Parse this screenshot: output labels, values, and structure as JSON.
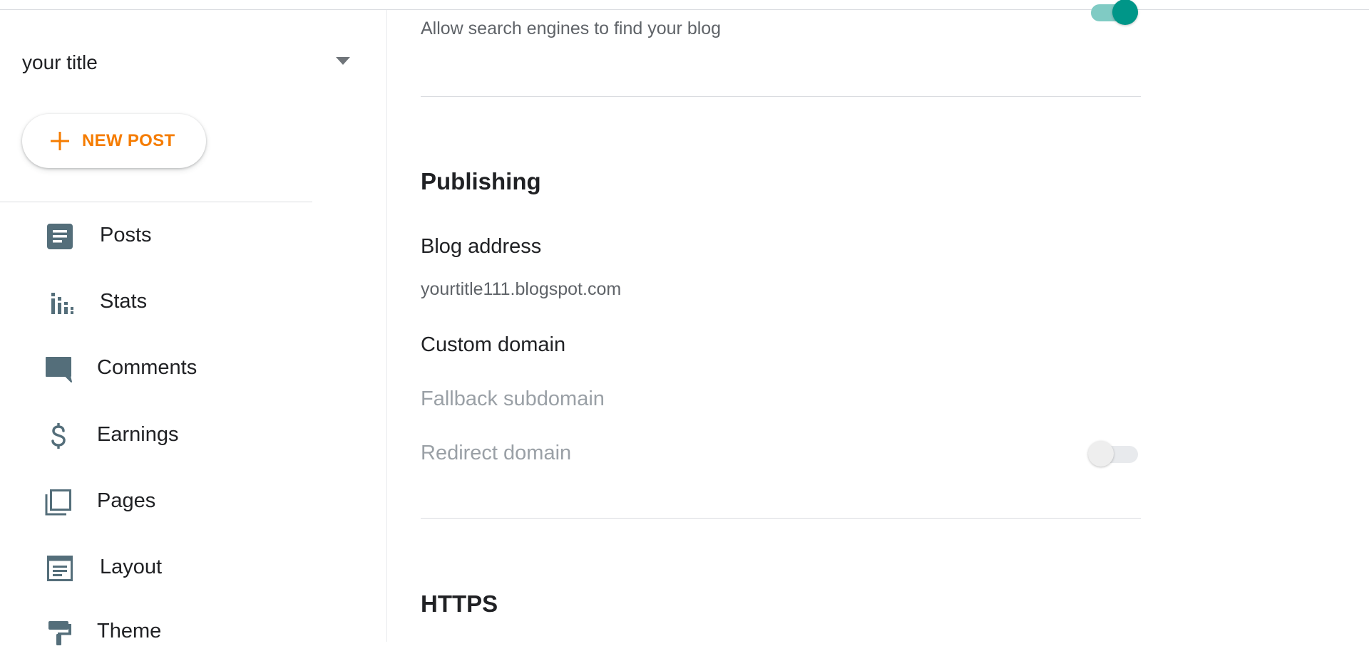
{
  "sidebar": {
    "blog_title": "your title",
    "new_post_label": "NEW POST",
    "items": [
      {
        "label": "Posts",
        "icon": "posts-icon"
      },
      {
        "label": "Stats",
        "icon": "stats-icon"
      },
      {
        "label": "Comments",
        "icon": "comments-icon"
      },
      {
        "label": "Earnings",
        "icon": "earnings-icon"
      },
      {
        "label": "Pages",
        "icon": "pages-icon"
      },
      {
        "label": "Layout",
        "icon": "layout-icon"
      },
      {
        "label": "Theme",
        "icon": "theme-icon"
      }
    ]
  },
  "main": {
    "privacy": {
      "search_description": "Allow search engines to find your blog",
      "search_visible": true
    },
    "publishing": {
      "heading": "Publishing",
      "blog_address_label": "Blog address",
      "blog_address_value": "yourtitle111.blogspot.com",
      "custom_domain_label": "Custom domain",
      "fallback_subdomain_label": "Fallback subdomain",
      "redirect_domain_label": "Redirect domain",
      "redirect_domain_enabled": false
    },
    "https": {
      "heading": "HTTPS"
    }
  },
  "colors": {
    "accent": "#f57c00",
    "toggle_on": "#009688",
    "icon": "#546e7a"
  }
}
